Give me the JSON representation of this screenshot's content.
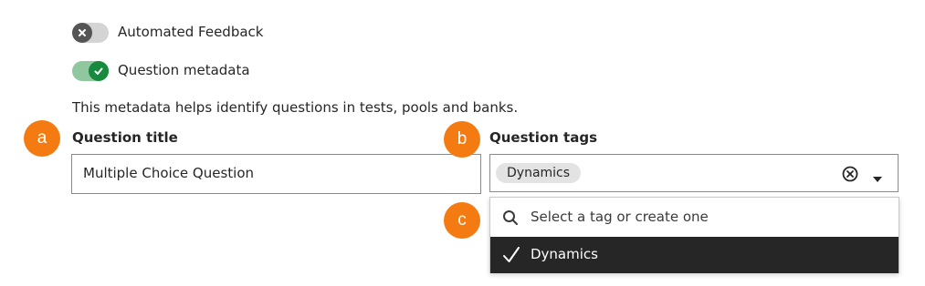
{
  "toggles": [
    {
      "label": "Automated Feedback",
      "state": "off",
      "icon": "close-icon"
    },
    {
      "label": "Question metadata",
      "state": "on",
      "icon": "check-icon"
    }
  ],
  "helper_text": "This metadata helps identify questions in tests, pools and banks.",
  "callouts": {
    "a": "a",
    "b": "b",
    "c": "c"
  },
  "question_title": {
    "label": "Question title",
    "value": "Multiple Choice Question"
  },
  "question_tags": {
    "label": "Question tags",
    "selected_chip": "Dynamics",
    "clear_icon": "clear-circle-icon",
    "dropdown_icon": "caret-down-icon"
  },
  "tag_dropdown": {
    "search_placeholder": "Select a tag or create one",
    "options": [
      {
        "label": "Dynamics",
        "selected": true
      }
    ]
  },
  "colors": {
    "accent_orange": "#f47a12",
    "toggle_on_track": "#8fc79e",
    "toggle_on_knob": "#178a3e",
    "toggle_off_track": "#d4d4d4",
    "toggle_off_knob": "#555555",
    "selected_option_bg": "#262626"
  }
}
